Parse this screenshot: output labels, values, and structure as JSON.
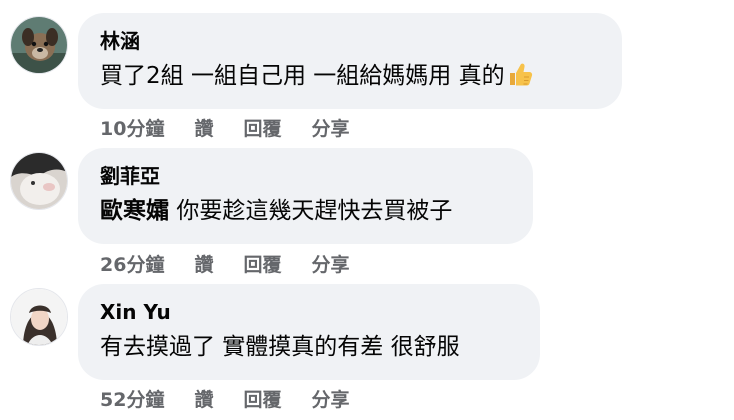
{
  "comments": [
    {
      "author": "林涵",
      "text": "買了2組 一組自己用 一組給媽媽用 真的",
      "emoji": "thumbs-up-icon",
      "time": "10分鐘",
      "like": "讚",
      "reply": "回覆",
      "share": "分享"
    },
    {
      "author": "劉菲亞",
      "mention": "歐寒孀",
      "text": "你要趁這幾天趕快去買被子",
      "time": "26分鐘",
      "like": "讚",
      "reply": "回覆",
      "share": "分享"
    },
    {
      "author": "Xin Yu",
      "text": "有去摸過了 實體摸真的有差 很舒服",
      "time": "52分鐘",
      "like": "讚",
      "reply": "回覆",
      "share": "分享"
    }
  ]
}
